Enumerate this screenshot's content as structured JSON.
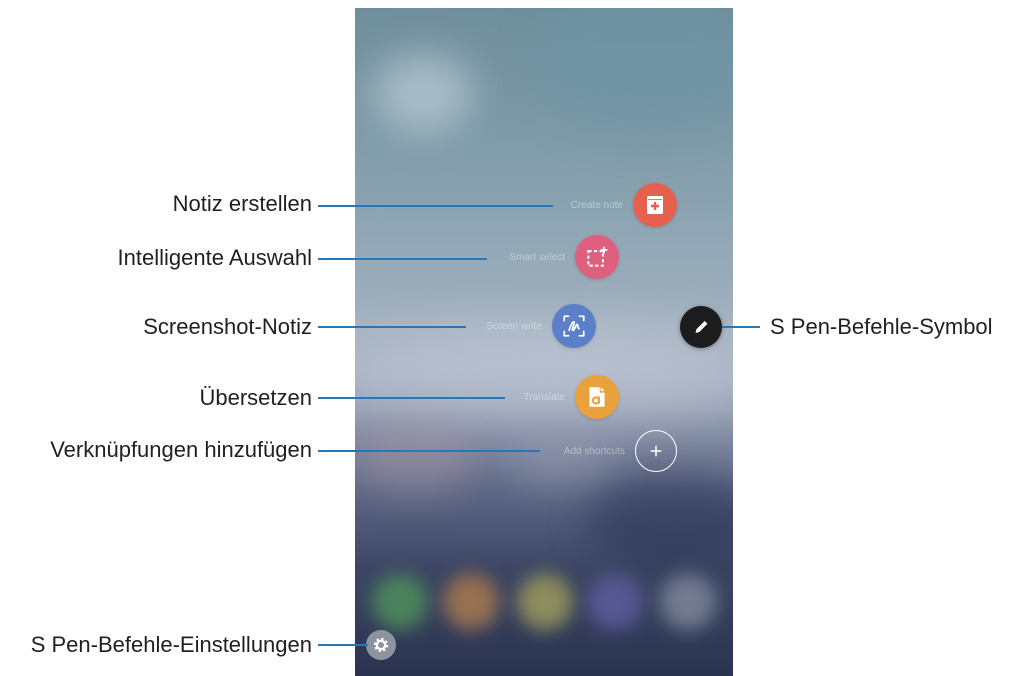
{
  "air_command": {
    "menu_items": [
      {
        "label": "Create note",
        "icon": "create-note-icon",
        "color": "#e5614d",
        "callout": "Notiz erstellen"
      },
      {
        "label": "Smart select",
        "icon": "smart-select-icon",
        "color": "#df5f7f",
        "callout": "Intelligente Auswahl"
      },
      {
        "label": "Screen write",
        "icon": "screen-write-icon",
        "color": "#5b7fc8",
        "callout": "Screenshot-Notiz"
      },
      {
        "label": "Translate",
        "icon": "translate-icon",
        "color": "#e9a23b",
        "callout": "Übersetzen"
      },
      {
        "label": "Add shortcuts",
        "icon": "add-shortcut-icon",
        "color": "#ffffff",
        "callout": "Verknüpfungen hinzufügen"
      }
    ],
    "command_icon": {
      "icon": "pen-icon",
      "color": "#1c1c1e",
      "callout": "S Pen-Befehle-Symbol"
    },
    "settings": {
      "icon": "gear-icon",
      "color": "#8d93a0",
      "callout": "S Pen-Befehle-Einstellungen"
    }
  },
  "colors": {
    "callout_line": "#2a77b6",
    "callout_text": "#231f20"
  }
}
